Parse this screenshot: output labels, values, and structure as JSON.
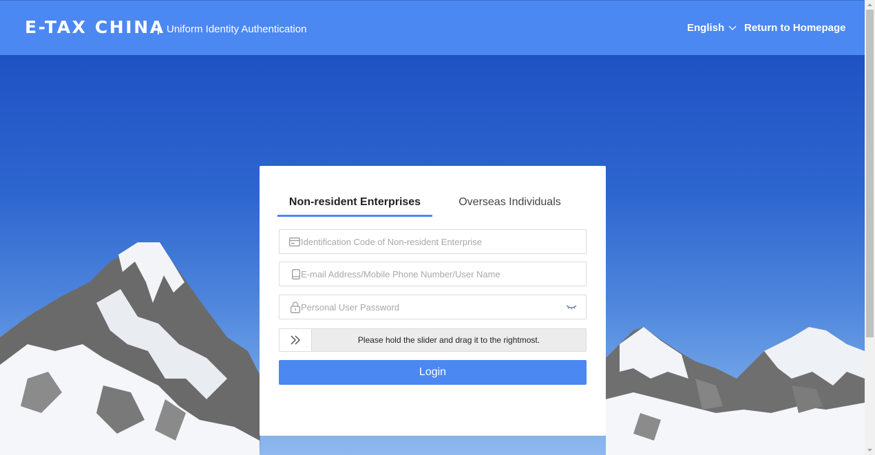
{
  "header": {
    "logo": "E-TAX CHINA",
    "subtitle": "Uniform Identity Authentication",
    "language": "English",
    "return_link": "Return to Homepage"
  },
  "login": {
    "tabs": [
      {
        "label": "Non-resident Enterprises",
        "active": true
      },
      {
        "label": "Overseas Individuals",
        "active": false
      }
    ],
    "fields": {
      "id_code": {
        "placeholder": "Identification Code of Non-resident Enterprise",
        "value": "",
        "icon": "id-card-icon"
      },
      "account": {
        "placeholder": "E-mail Address/Mobile Phone Number/User Name",
        "value": "",
        "icon": "phone-icon"
      },
      "password": {
        "placeholder": "Personal User Password",
        "value": "",
        "icon": "lock-icon"
      }
    },
    "slider": {
      "text": "Please hold the slider and drag it to the rightmost.",
      "icon": "double-chevron-right-icon"
    },
    "login_button": "Login"
  },
  "colors": {
    "header": "#4b88f2",
    "primary": "#4b88f2",
    "background_sky": "#2357c2"
  }
}
